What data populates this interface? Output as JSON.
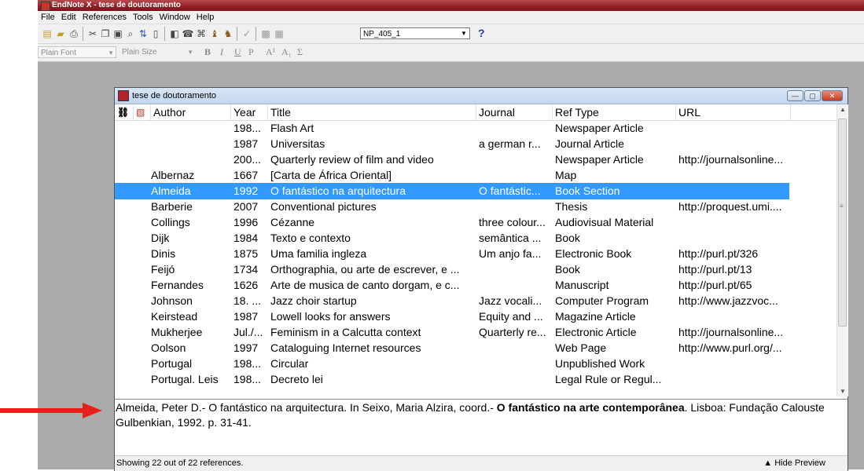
{
  "app": {
    "title": "EndNote X - tese de doutoramento"
  },
  "menu": [
    "File",
    "Edit",
    "References",
    "Tools",
    "Window",
    "Help"
  ],
  "toolbar": {
    "style_value": "NP_405_1",
    "help": "?"
  },
  "format_bar": {
    "font": "Plain Font",
    "size": "Plain Size",
    "bold": "B",
    "italic": "I",
    "underline": "U",
    "plain": "P",
    "superscript": "A¹",
    "subscript": "A₁",
    "symbol": "Σ"
  },
  "library": {
    "title": "tese de doutoramento",
    "columns": {
      "author": "Author",
      "year": "Year",
      "title": "Title",
      "journal": "Journal",
      "reftype": "Ref Type",
      "url": "URL"
    },
    "rows": [
      {
        "author": "",
        "year": "198...",
        "title": "Flash Art",
        "journal": "",
        "reftype": "Newspaper Article",
        "url": ""
      },
      {
        "author": "",
        "year": "1987",
        "title": "Universitas",
        "journal": "a german r...",
        "reftype": "Journal Article",
        "url": ""
      },
      {
        "author": "",
        "year": "200...",
        "title": "Quarterly review of film and video",
        "journal": "",
        "reftype": "Newspaper Article",
        "url": "http://journalsonline..."
      },
      {
        "author": "Albernaz",
        "year": "1667",
        "title": "[Carta de África Oriental]",
        "journal": "",
        "reftype": "Map",
        "url": ""
      },
      {
        "author": "Almeida",
        "year": "1992",
        "title": "O fantástico na arquitectura",
        "journal": "O fantástic...",
        "reftype": "Book Section",
        "url": ""
      },
      {
        "author": "Barberie",
        "year": "2007",
        "title": "Conventional pictures",
        "journal": "",
        "reftype": "Thesis",
        "url": "http://proquest.umi...."
      },
      {
        "author": "Collings",
        "year": "1996",
        "title": "Cézanne",
        "journal": "three colour...",
        "reftype": "Audiovisual Material",
        "url": ""
      },
      {
        "author": "Dijk",
        "year": "1984",
        "title": "Texto e contexto",
        "journal": "semântica ...",
        "reftype": "Book",
        "url": ""
      },
      {
        "author": "Dinis",
        "year": "1875",
        "title": "Uma familia ingleza",
        "journal": "Um anjo fa...",
        "reftype": "Electronic Book",
        "url": "http://purl.pt/326"
      },
      {
        "author": "Feijó",
        "year": "1734",
        "title": "Orthographia, ou arte de escrever, e ...",
        "journal": "",
        "reftype": "Book",
        "url": "http://purl.pt/13"
      },
      {
        "author": "Fernandes",
        "year": "1626",
        "title": "Arte de musica de canto dorgam, e c...",
        "journal": "",
        "reftype": "Manuscript",
        "url": "http://purl.pt/65"
      },
      {
        "author": "Johnson",
        "year": "18. ...",
        "title": "Jazz choir startup",
        "journal": "Jazz vocali...",
        "reftype": "Computer Program",
        "url": "http://www.jazzvoc..."
      },
      {
        "author": "Keirstead",
        "year": "1987",
        "title": "Lowell looks for answers",
        "journal": "Equity and ...",
        "reftype": "Magazine Article",
        "url": ""
      },
      {
        "author": "Mukherjee",
        "year": "Jul./...",
        "title": "Feminism in a Calcutta context",
        "journal": "Quarterly re...",
        "reftype": "Electronic Article",
        "url": "http://journalsonline..."
      },
      {
        "author": "Oolson",
        "year": "1997",
        "title": "Cataloguing Internet resources",
        "journal": "",
        "reftype": "Web Page",
        "url": "http://www.purl.org/..."
      },
      {
        "author": "Portugal",
        "year": "198...",
        "title": "Circular",
        "journal": "",
        "reftype": "Unpublished Work",
        "url": ""
      },
      {
        "author": "Portugal. Leis",
        "year": "198...",
        "title": "Decreto lei",
        "journal": "",
        "reftype": "Legal Rule or Regul...",
        "url": ""
      }
    ],
    "selected_index": 4
  },
  "preview": {
    "part1": "Almeida, Peter D.- O fantástico na arquitectura.  In  Seixo, Maria Alzira, coord.- ",
    "bold": "O fantástico na arte contemporânea",
    "part2": ". Lisboa: Fundação Calouste Gulbenkian, 1992. p.  31-41."
  },
  "status": {
    "text": "Showing 22 out of 22 references.",
    "hide_preview": "Hide Preview"
  },
  "colors": {
    "selection": "#3399ff",
    "titlebar": "#8f1f24",
    "arrow": "#e8201c"
  }
}
